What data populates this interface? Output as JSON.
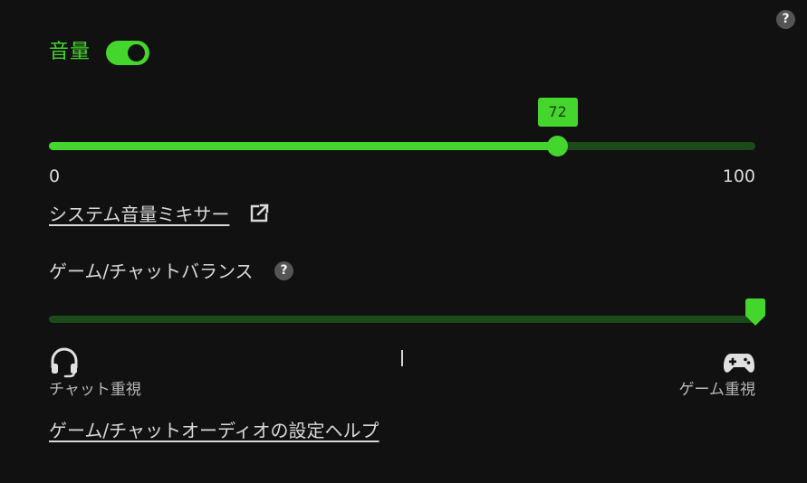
{
  "help_corner": {
    "label": "?"
  },
  "volume": {
    "title": "音量",
    "enabled": true,
    "value": 72,
    "value_label": "72",
    "min_label": "0",
    "max_label": "100",
    "min": 0,
    "max": 100
  },
  "mixer_link": {
    "label": "システム音量ミキサー",
    "icon": "external-link-icon"
  },
  "balance": {
    "label": "ゲーム/チャットバランス",
    "help_label": "?",
    "position_fraction": 1.0,
    "chat_label": "チャット重視",
    "game_label": "ゲーム重視",
    "chat_icon": "headset-icon",
    "game_icon": "gamepad-icon"
  },
  "help_link": {
    "label": "ゲーム/チャットオーディオの設定ヘルプ"
  },
  "colors": {
    "background": "#111111",
    "accent": "#44d62c",
    "track_dim": "#1d4a1a",
    "text": "#d9d9d9",
    "help_circle": "#555555"
  }
}
